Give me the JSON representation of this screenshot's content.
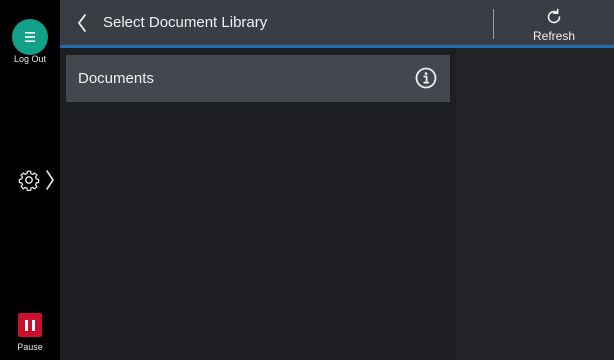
{
  "sidebar": {
    "logout_label": "Log Out",
    "pause_label": "Pause",
    "icons": {
      "logout": "menu-lines-icon",
      "settings": "gear-icon",
      "expand": "chevron-right-icon",
      "pause": "pause-icon"
    },
    "colors": {
      "logout_button": "#12a089",
      "pause_button": "#c8102e"
    }
  },
  "header": {
    "title": "Select Document Library",
    "refresh_label": "Refresh",
    "icons": {
      "back": "chevron-left-icon",
      "refresh": "refresh-icon"
    },
    "accent_color": "#1f6fb5"
  },
  "library_list": {
    "items": [
      {
        "label": "Documents",
        "icon": "info-icon"
      }
    ]
  }
}
